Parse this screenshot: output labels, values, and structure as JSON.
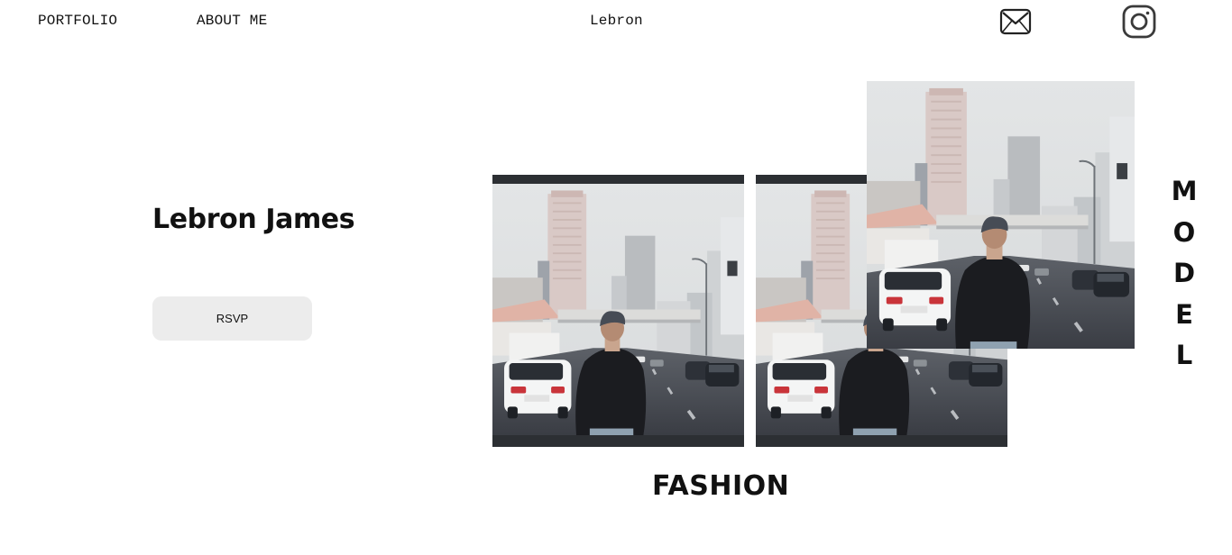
{
  "nav": {
    "portfolio": "PORTFOLIO",
    "about": "ABOUT ME",
    "brand": "Lebron"
  },
  "icons": {
    "mail": "mail-icon",
    "instagram": "instagram-icon"
  },
  "hero": {
    "name": "Lebron James",
    "rsvp_label": "RSVP"
  },
  "side_text": [
    "M",
    "O",
    "D",
    "E",
    "L"
  ],
  "caption": "FASHION"
}
